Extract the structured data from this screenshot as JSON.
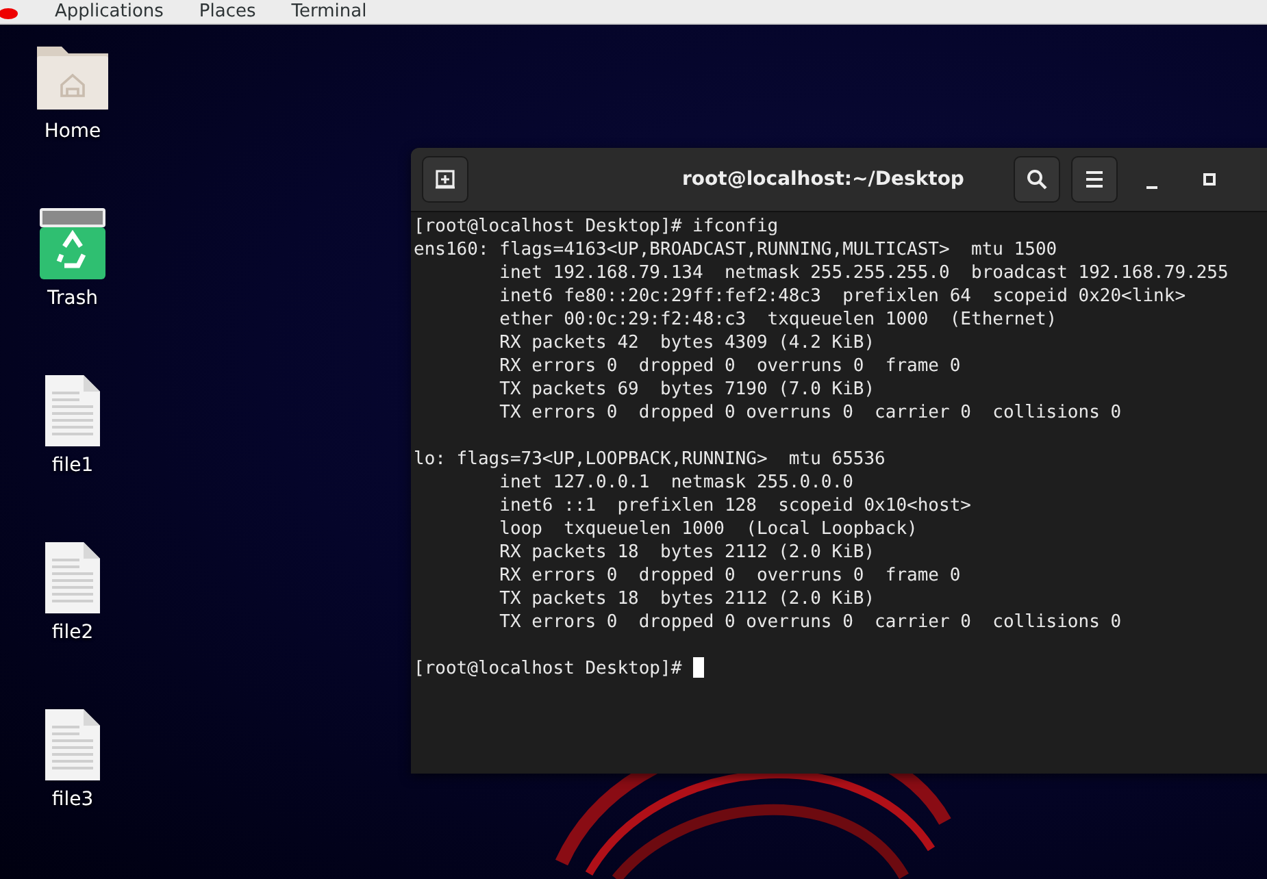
{
  "top_bar": {
    "menus": [
      "Applications",
      "Places",
      "Terminal"
    ]
  },
  "desktop_icons": [
    {
      "kind": "folder",
      "label": "Home"
    },
    {
      "kind": "trash",
      "label": "Trash"
    },
    {
      "kind": "file",
      "label": "file1"
    },
    {
      "kind": "file",
      "label": "file2"
    },
    {
      "kind": "file",
      "label": "file3"
    }
  ],
  "terminal": {
    "title": "root@localhost:~/Desktop",
    "sections": [
      {
        "lines": [
          {
            "kind": "prompt",
            "text": "[root@localhost Desktop]# ifconfig"
          },
          {
            "kind": "output",
            "text": "ens160: flags=4163<UP,BROADCAST,RUNNING,MULTICAST>  mtu 1500"
          },
          {
            "kind": "output",
            "text": "        inet 192.168.79.134  netmask 255.255.255.0  broadcast 192.168.79.255"
          },
          {
            "kind": "output",
            "text": "        inet6 fe80::20c:29ff:fef2:48c3  prefixlen 64  scopeid 0x20<link>"
          },
          {
            "kind": "output",
            "text": "        ether 00:0c:29:f2:48:c3  txqueuelen 1000  (Ethernet)"
          },
          {
            "kind": "output",
            "text": "        RX packets 42  bytes 4309 (4.2 KiB)"
          },
          {
            "kind": "output",
            "text": "        RX errors 0  dropped 0  overruns 0  frame 0"
          },
          {
            "kind": "output",
            "text": "        TX packets 69  bytes 7190 (7.0 KiB)"
          },
          {
            "kind": "output",
            "text": "        TX errors 0  dropped 0 overruns 0  carrier 0  collisions 0"
          }
        ]
      },
      {
        "lines": [
          {
            "kind": "output",
            "text": "lo: flags=73<UP,LOOPBACK,RUNNING>  mtu 65536"
          },
          {
            "kind": "output",
            "text": "        inet 127.0.0.1  netmask 255.0.0.0"
          },
          {
            "kind": "output",
            "text": "        inet6 ::1  prefixlen 128  scopeid 0x10<host>"
          },
          {
            "kind": "output",
            "text": "        loop  txqueuelen 1000  (Local Loopback)"
          },
          {
            "kind": "output",
            "text": "        RX packets 18  bytes 2112 (2.0 KiB)"
          },
          {
            "kind": "output",
            "text": "        RX errors 0  dropped 0  overruns 0  frame 0"
          },
          {
            "kind": "output",
            "text": "        TX packets 18  bytes 2112 (2.0 KiB)"
          },
          {
            "kind": "output",
            "text": "        TX errors 0  dropped 0 overruns 0  carrier 0  collisions 0"
          }
        ]
      },
      {
        "lines": [
          {
            "kind": "prompt",
            "text": "[root@localhost Desktop]# ",
            "cursor": true
          }
        ]
      }
    ]
  }
}
